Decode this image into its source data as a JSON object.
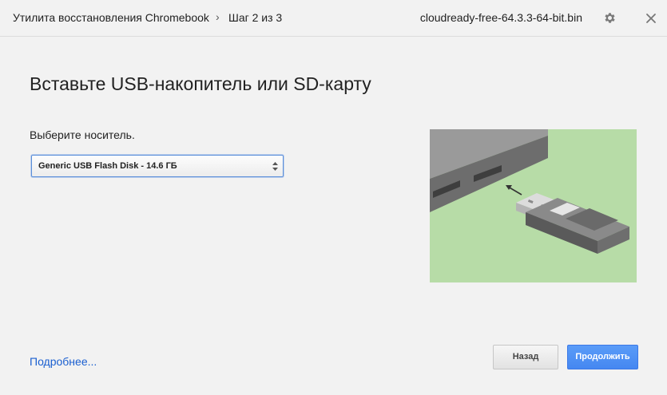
{
  "header": {
    "app_title": "Утилита восстановления Chromebook",
    "separator": "›",
    "step": "Шаг 2 из 3",
    "file_name": "cloudready-free-64.3.3-64-bit.bin"
  },
  "main": {
    "title": "Вставьте USB-накопитель или SD-карту",
    "select_label": "Выберите носитель.",
    "select_value": "Generic USB Flash Disk - 14.6 ГБ"
  },
  "footer": {
    "more_link": "Подробнее...",
    "back_label": "Назад",
    "continue_label": "Продолжить"
  },
  "colors": {
    "accent": "#4a8af4",
    "link": "#1a5fd0",
    "illustration_bg": "#b7dca7"
  }
}
